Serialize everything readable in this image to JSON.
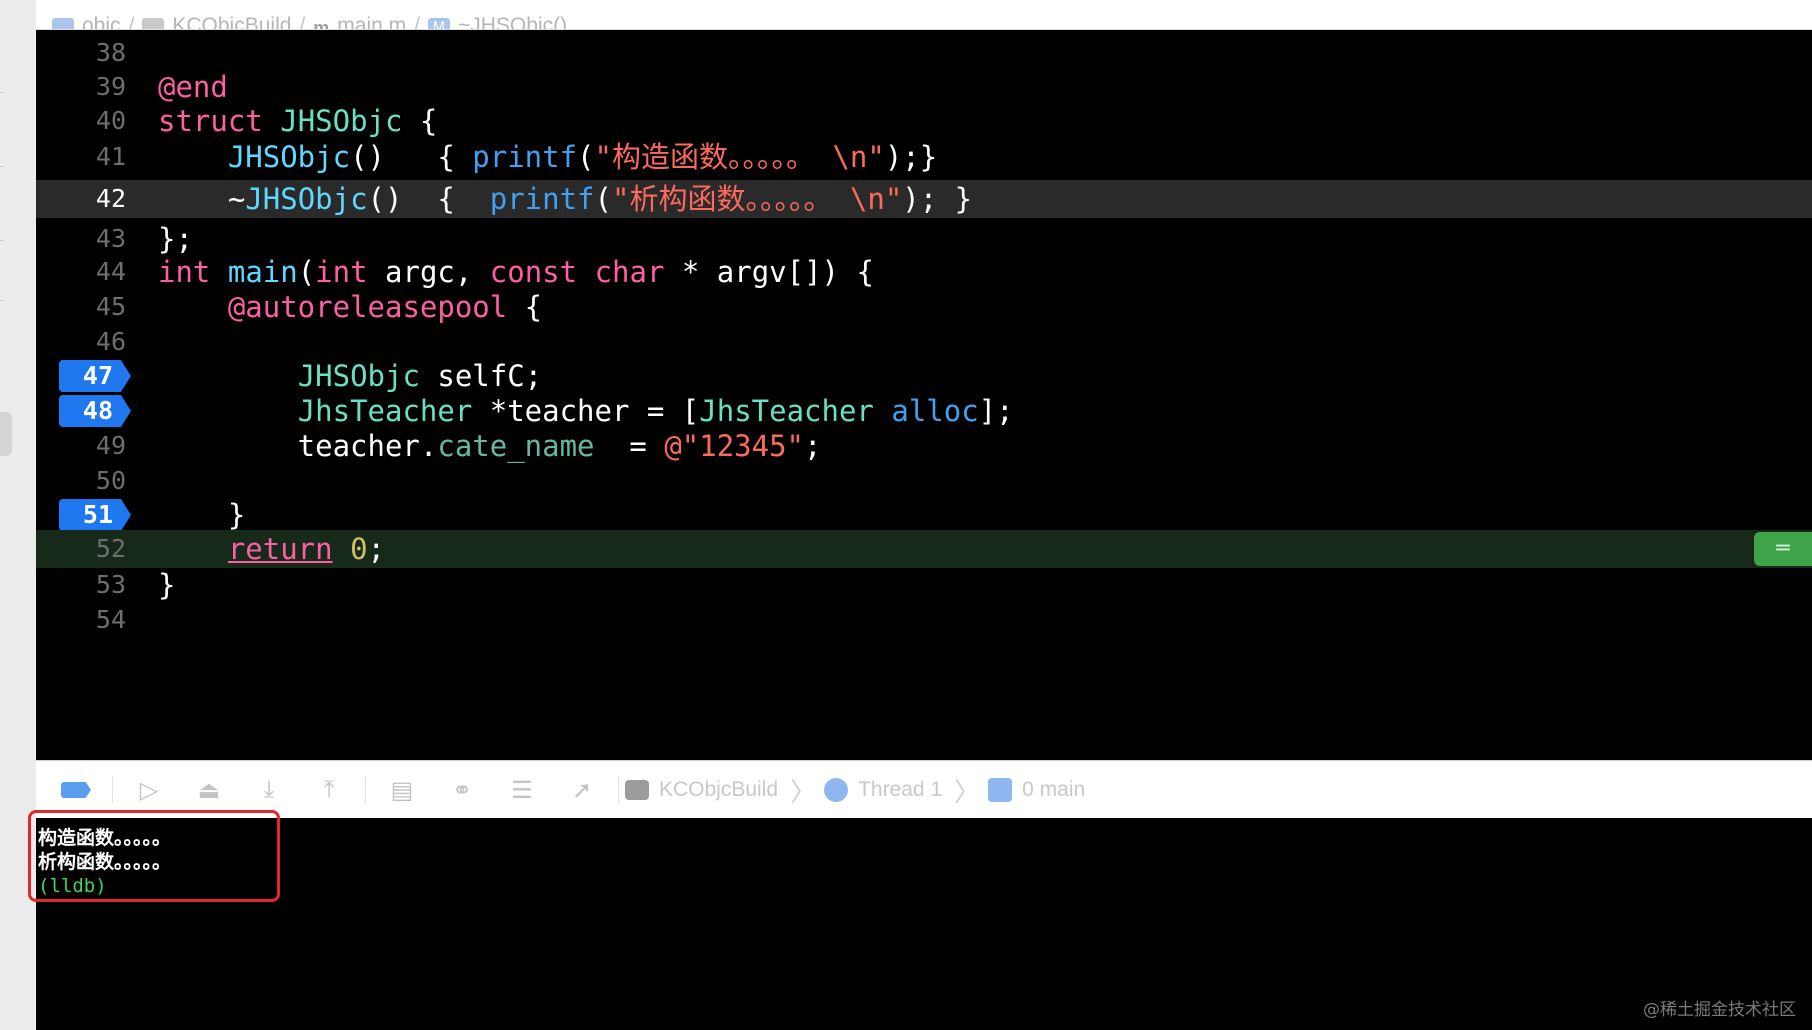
{
  "jumpbar": {
    "crumbs": [
      {
        "label": "objc",
        "icon": "project-icon"
      },
      {
        "label": "KCObjcBuild",
        "icon": "folder-icon"
      },
      {
        "label": "main.m",
        "icon": "m-file-icon"
      },
      {
        "label": "~JHSObjc()",
        "icon": "method-icon"
      }
    ]
  },
  "editor": {
    "lines": [
      {
        "no": "38",
        "tokens": []
      },
      {
        "no": "39",
        "tokens": [
          {
            "t": "@end",
            "c": "kw"
          }
        ]
      },
      {
        "no": "40",
        "tokens": [
          {
            "t": "struct",
            "c": "kw"
          },
          {
            "t": " "
          },
          {
            "t": "JHSObjc",
            "c": "cls"
          },
          {
            "t": " {"
          }
        ]
      },
      {
        "no": "41",
        "tokens": [
          {
            "t": "    "
          },
          {
            "t": "JHSObjc",
            "c": "ty"
          },
          {
            "t": "()   { "
          },
          {
            "t": "printf",
            "c": "fn"
          },
          {
            "t": "("
          },
          {
            "t": "\"构造函数。。。。。 \\n\"",
            "c": "str"
          },
          {
            "t": ");}"
          }
        ]
      },
      {
        "no": "42",
        "current": true,
        "tokens": [
          {
            "t": "    ~"
          },
          {
            "t": "JHSObjc",
            "c": "ty"
          },
          {
            "t": "()  {  "
          },
          {
            "t": "printf",
            "c": "fn"
          },
          {
            "t": "("
          },
          {
            "t": "\"析构函数。。。。。 \\n\"",
            "c": "str"
          },
          {
            "t": "); }"
          }
        ]
      },
      {
        "no": "43",
        "tokens": [
          {
            "t": "};"
          }
        ]
      },
      {
        "no": "44",
        "tokens": [
          {
            "t": "int",
            "c": "kw"
          },
          {
            "t": " "
          },
          {
            "t": "main",
            "c": "ty"
          },
          {
            "t": "("
          },
          {
            "t": "int",
            "c": "kw"
          },
          {
            "t": " argc, "
          },
          {
            "t": "const",
            "c": "kw"
          },
          {
            "t": " "
          },
          {
            "t": "char",
            "c": "kw"
          },
          {
            "t": " * argv[]) {"
          }
        ]
      },
      {
        "no": "45",
        "tokens": [
          {
            "t": "    "
          },
          {
            "t": "@autoreleasepool",
            "c": "kw"
          },
          {
            "t": " {"
          }
        ]
      },
      {
        "no": "46",
        "tokens": []
      },
      {
        "no": "47",
        "breakpoint": true,
        "tokens": [
          {
            "t": "        "
          },
          {
            "t": "JHSObjc",
            "c": "cls"
          },
          {
            "t": " selfC;"
          }
        ]
      },
      {
        "no": "48",
        "breakpoint": true,
        "tokens": [
          {
            "t": "        "
          },
          {
            "t": "JhsTeacher",
            "c": "cls"
          },
          {
            "t": " *teacher = ["
          },
          {
            "t": "JhsTeacher",
            "c": "cls"
          },
          {
            "t": " "
          },
          {
            "t": "alloc",
            "c": "fn"
          },
          {
            "t": "];"
          }
        ]
      },
      {
        "no": "49",
        "tokens": [
          {
            "t": "        teacher."
          },
          {
            "t": "cate_name",
            "c": "prop"
          },
          {
            "t": "  = "
          },
          {
            "t": "@\"12345\"",
            "c": "str"
          },
          {
            "t": ";"
          }
        ]
      },
      {
        "no": "50",
        "tokens": []
      },
      {
        "no": "51",
        "breakpoint": true,
        "tokens": [
          {
            "t": "    }"
          }
        ]
      },
      {
        "no": "52",
        "pc": true,
        "tokens": [
          {
            "t": "    "
          },
          {
            "t": "return",
            "c": "kw ret"
          },
          {
            "t": " "
          },
          {
            "t": "0",
            "c": "num"
          },
          {
            "t": ";"
          }
        ]
      },
      {
        "no": "53",
        "tokens": [
          {
            "t": "}"
          }
        ]
      },
      {
        "no": "54",
        "tokens": []
      }
    ],
    "pc_indicator_glyph": "═"
  },
  "debugbar": {
    "buttons": [
      {
        "name": "breakpoints-toggle-button",
        "glyph": ""
      },
      {
        "name": "continue-button",
        "glyph": "▷"
      },
      {
        "name": "step-over-button",
        "glyph": "⏏"
      },
      {
        "name": "step-into-button",
        "glyph": "⤓"
      },
      {
        "name": "step-out-button",
        "glyph": "⤒"
      },
      {
        "name": "view-hierarchy-button",
        "glyph": "▤"
      },
      {
        "name": "memory-graph-button",
        "glyph": "⚭"
      },
      {
        "name": "environment-overrides-button",
        "glyph": "☰"
      },
      {
        "name": "simulate-location-button",
        "glyph": "➚"
      }
    ],
    "crumbs": [
      {
        "label": "KCObjcBuild",
        "icon": "terminal-icon"
      },
      {
        "label": "Thread 1",
        "icon": "thread-icon"
      },
      {
        "label": "0 main",
        "icon": "stack-frame-icon"
      }
    ]
  },
  "console": {
    "lines": [
      "构造函数。。。。。",
      "析构函数。。。。。"
    ],
    "prompt": "(lldb)"
  },
  "watermark": "@稀土掘金技术社区"
}
